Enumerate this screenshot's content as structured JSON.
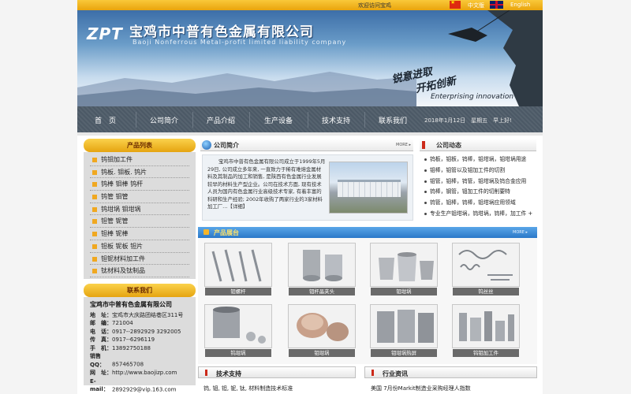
{
  "topbar": {
    "welcome": "欢迎访问宝鸡",
    "lang_cn": "中文版",
    "lang_en": "English"
  },
  "banner": {
    "logo": "ZPT",
    "company_cn": "宝鸡市中普有色金属有限公司",
    "company_en": "Baoji Nonferrous Metal-profit limited liability company",
    "slogan_line1": "锐意进取",
    "slogan_line2": "开拓创新",
    "tagline": "Enterprising innovation"
  },
  "nav": {
    "items": [
      "首　页",
      "公司简介",
      "产品介绍",
      "生产设备",
      "技术支持",
      "联系我们"
    ],
    "date": "2018年1月12日　星期五　早上好!"
  },
  "sidebar": {
    "product_list_title": "产品列表",
    "items": [
      "钨钼加工件",
      "钨板. 钼板. 钨片",
      "钨棒 钼棒 钨杆",
      "钨管 钼管",
      "钨坩埚 钼坩埚",
      "钽管 铌管",
      "钽棒 铌棒",
      "钽板 铌板 钽片",
      "钽铌材料加工件",
      "钛材料及钛制品"
    ],
    "contact_title": "联系我们",
    "contact": {
      "company": "宝鸡市中普有色金属有限公司",
      "rows": [
        {
          "label": "地　址：",
          "value": "宝鸡市大庆路团结巷区311号"
        },
        {
          "label": "邮　编：",
          "value": "721004"
        },
        {
          "label": "电　话：",
          "value": "0917--2892929 3292005"
        },
        {
          "label": "传　真：",
          "value": "0917--6296119"
        },
        {
          "label": "手　机：",
          "value": "13892750188"
        },
        {
          "label": "销售QQ：",
          "value": "857465708"
        },
        {
          "label": "网　址：",
          "value": "http://www.baojizp.com"
        },
        {
          "label": "E-mail：",
          "value": "2892929@vip.163.com"
        }
      ]
    }
  },
  "about": {
    "title": "公司简介",
    "more": "MORE ▸",
    "text": "宝鸡市中普有色金属有限公司成立于1999年5月29日, 公司成立多年来, 一直致力于稀有难熔金属材料及其制品的加工和销售, 是陕西有色金属行业发展较早的材料生产型企业。公司在技术方面, 现有技术人员为国内有色金属行业高级技术专家, 有着丰富的科研和生产经验; 2002年收购了两家行业的3家材料加工厂…【详细】"
  },
  "news": {
    "title": "公司动态",
    "more": "MORE ▸",
    "items": [
      "钨板，钼板，钨棒，钼坩埚，钼坩埚用途",
      "钼棒，钼管以及钼加工件的切割",
      "钼管，钼棒，钨管，钼坩埚及钨合金应用",
      "钨棒，钢管，钼加工件的切削要特",
      "钨管，钼棒，钨棒，钼坩埚应用领域",
      "专业生产钼坩埚，钨坩埚，钨棒，加工件 +"
    ]
  },
  "products": {
    "title": "产品展台",
    "more": "MORE ▸",
    "items": [
      "钼螺杆",
      "钼杆晶夹头",
      "钼坩埚",
      "钨丝丝",
      "钨坩埚",
      "钼坩埚",
      "钼坩埚热屏",
      "钨钼加工件"
    ]
  },
  "tech": {
    "title": "技术支持",
    "line": "钨, 钼, 钽, 铌, 钛, 材料制造技术标准"
  },
  "industry": {
    "title": "行业资讯",
    "line": "美国 7月份Markit制造业采购经理人指数"
  }
}
